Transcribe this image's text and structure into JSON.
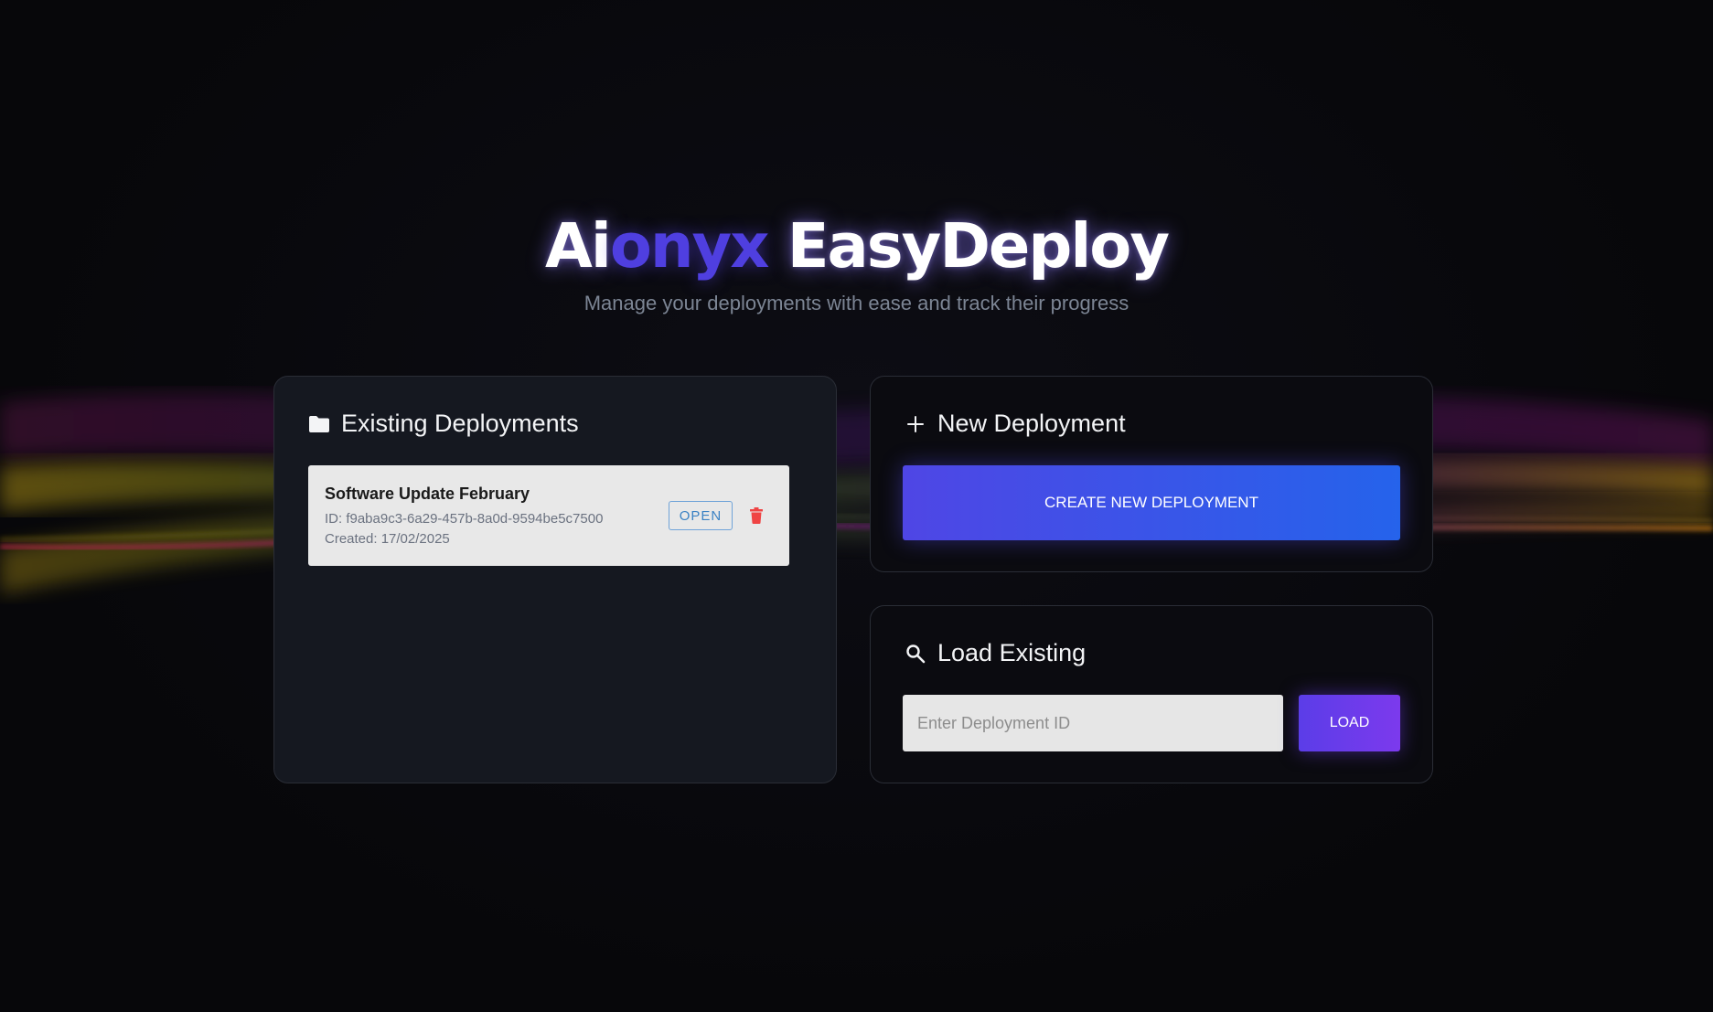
{
  "header": {
    "title_part1": "Ai",
    "title_part2": "onyx",
    "title_part3": " EasyDeploy",
    "subtitle": "Manage your deployments with ease and track their progress"
  },
  "existing": {
    "heading": "Existing Deployments",
    "icon": "folder-icon",
    "items": [
      {
        "name": "Software Update February",
        "id_line": "ID: f9aba9c3-6a29-457b-8a0d-9594be5c7500",
        "created_line": "Created: 17/02/2025",
        "open_label": "OPEN",
        "delete_icon": "trash-icon"
      }
    ]
  },
  "new_deployment": {
    "heading": "New Deployment",
    "icon": "plus-icon",
    "button_label": "CREATE NEW DEPLOYMENT"
  },
  "load_existing": {
    "heading": "Load Existing",
    "icon": "search-icon",
    "input_placeholder": "Enter Deployment ID",
    "input_value": "",
    "button_label": "LOAD"
  },
  "colors": {
    "accent": "#4f3fe0",
    "create_gradient_start": "#4f46e5",
    "create_gradient_end": "#2563eb",
    "load_button": "#6d3deb",
    "delete": "#ef4444"
  }
}
